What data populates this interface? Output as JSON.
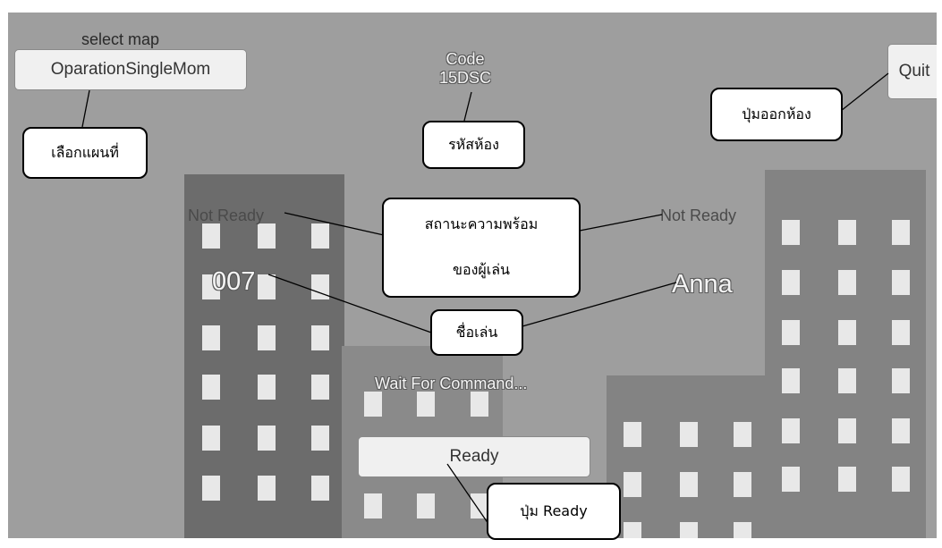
{
  "map": {
    "caption": "select map",
    "selected": "OparationSingleMom"
  },
  "room": {
    "code_label": "Code",
    "code_value": "15DSC"
  },
  "quit_label": "Quit",
  "players": [
    {
      "status": "Not Ready",
      "name": "007"
    },
    {
      "status": "Not Ready",
      "name": "Anna"
    }
  ],
  "lobby_status": "Wait For Command...",
  "ready_label": "Ready",
  "annotations": {
    "select_map": "เลือกแผนที่",
    "room_code": "รหัสห้อง",
    "quit_button": "ปุ่มออกห้อง",
    "ready_status_line1": "สถานะความพร้อม",
    "ready_status_line2": "ของผู้เล่น",
    "player_name": "ชื่อเล่น",
    "ready_button": "ปุ่ม Ready"
  }
}
